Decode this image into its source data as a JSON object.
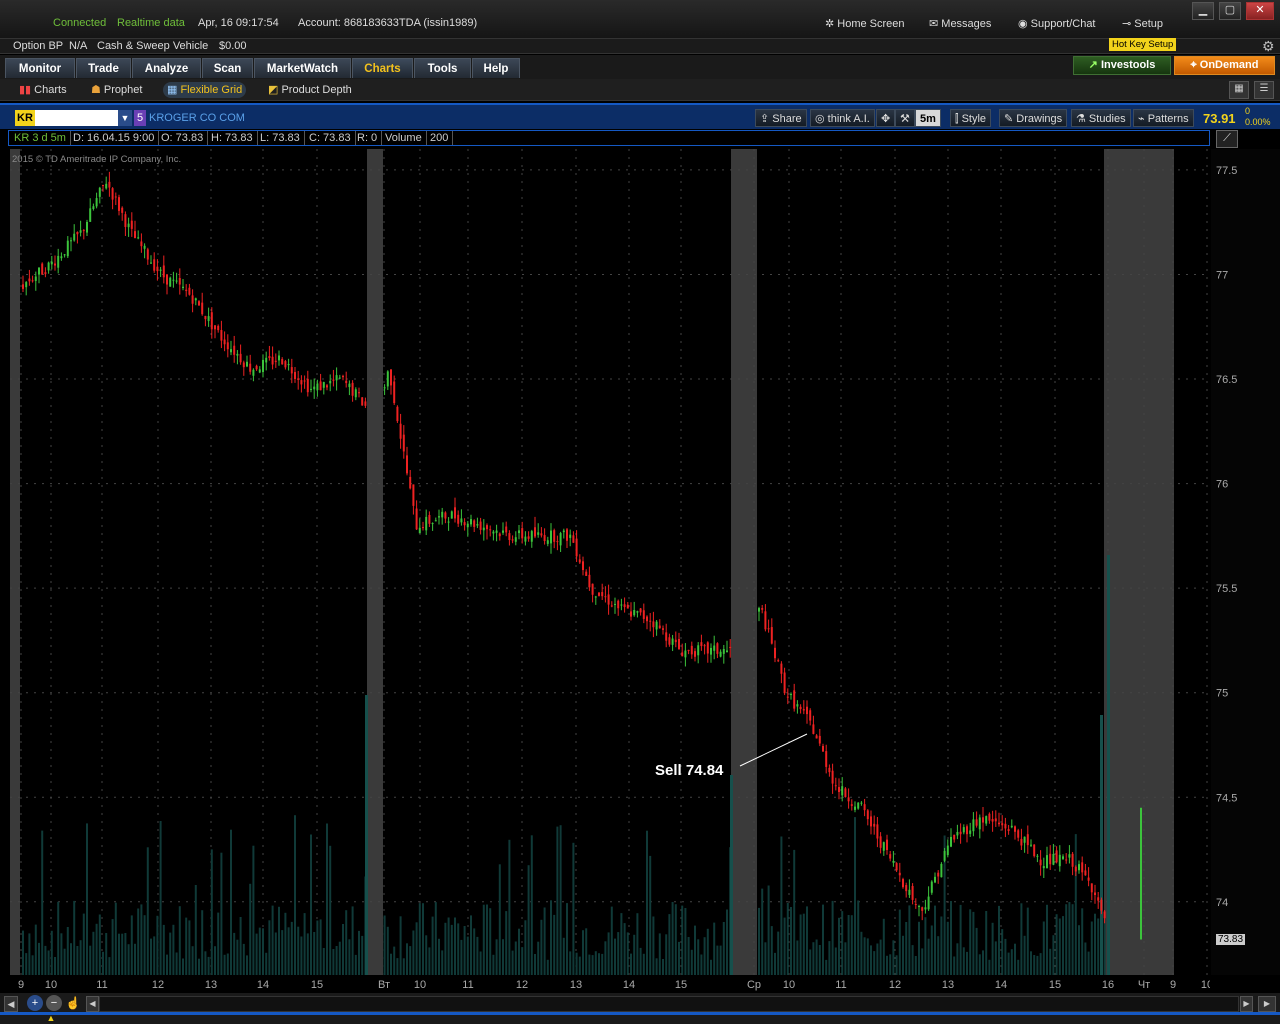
{
  "status": {
    "connected": "Connected",
    "realtime": "Realtime data",
    "datetime": "Apr, 16  09:17:54",
    "account": "Account: 868183633TDA (issin1989)"
  },
  "topnav": {
    "home": "Home Screen",
    "messages": "Messages",
    "support": "Support/Chat",
    "setup": "Setup",
    "hotkey": "Hot Key Setup"
  },
  "account": {
    "option_bp_label": "Option BP",
    "option_bp_value": "N/A",
    "cash_label": "Cash & Sweep Vehicle",
    "cash_value": "$0.00"
  },
  "tabs": [
    "Monitor",
    "Trade",
    "Analyze",
    "Scan",
    "MarketWatch",
    "Charts",
    "Tools",
    "Help"
  ],
  "right_buttons": {
    "investools": "Investools",
    "ondemand": "OnDemand"
  },
  "subtabs": [
    "Charts",
    "Prophet",
    "Flexible Grid",
    "Product Depth"
  ],
  "chart_header": {
    "symbol": "KR",
    "badge": "5",
    "company": "KROGER CO COM",
    "share": "Share",
    "thinkai": "think A.I.",
    "timeframe": "5m",
    "style": "Style",
    "drawings": "Drawings",
    "studies": "Studies",
    "patterns": "Patterns",
    "last_price": "73.91",
    "change": "0",
    "change_pct": "0.00%"
  },
  "study_row": {
    "name": "KR 3 d 5m",
    "date": "D: 16.04.15 9:00",
    "open": "O: 73.83",
    "high": "H: 73.83",
    "low": "L: 73.83",
    "close": "C: 73.83",
    "range": "R: 0",
    "volume_label": "Volume",
    "volume_value": "200"
  },
  "copyright": "2015 © TD Ameritrade IP Company, Inc.",
  "annotation": "Sell 74.84",
  "chart_data": {
    "type": "candlestick",
    "title": "KR 3 d 5m",
    "ylim": [
      73.65,
      77.6
    ],
    "y_ticks": [
      74,
      74.5,
      75,
      75.5,
      76,
      76.5,
      77,
      77.5
    ],
    "x_tick_labels": [
      "9",
      "10",
      "11",
      "12",
      "13",
      "14",
      "15",
      "Вт",
      "10",
      "11",
      "12",
      "13",
      "14",
      "15",
      "Ср",
      "10",
      "11",
      "12",
      "13",
      "14",
      "15",
      "16",
      "Чт",
      "9",
      "10"
    ],
    "price_path": [
      [
        "9:30",
        76.95
      ],
      [
        "10:00",
        77.05
      ],
      [
        "10:30",
        77.2
      ],
      [
        "11:00",
        77.45
      ],
      [
        "11:30",
        77.2
      ],
      [
        "12:00",
        77.0
      ],
      [
        "12:30",
        76.9
      ],
      [
        "13:00",
        76.7
      ],
      [
        "13:30",
        76.55
      ],
      [
        "14:00",
        76.6
      ],
      [
        "14:30",
        76.45
      ],
      [
        "15:00",
        76.5
      ],
      [
        "15:30",
        76.4
      ],
      [
        "16:00",
        76.3
      ],
      [
        "Вт 9:30",
        76.55
      ],
      [
        "10:00",
        75.8
      ],
      [
        "10:30",
        75.85
      ],
      [
        "11:00",
        75.8
      ],
      [
        "11:30",
        75.75
      ],
      [
        "12:00",
        75.75
      ],
      [
        "12:30",
        75.75
      ],
      [
        "13:00",
        75.5
      ],
      [
        "13:30",
        75.4
      ],
      [
        "14:00",
        75.35
      ],
      [
        "14:30",
        75.2
      ],
      [
        "15:00",
        75.2
      ],
      [
        "16:00",
        75.2
      ],
      [
        "Ср 9:30",
        75.4
      ],
      [
        "10:00",
        75.0
      ],
      [
        "10:30",
        74.85
      ],
      [
        "11:00",
        74.55
      ],
      [
        "11:30",
        74.45
      ],
      [
        "12:00",
        74.2
      ],
      [
        "12:30",
        73.95
      ],
      [
        "13:00",
        74.3
      ],
      [
        "13:30",
        74.4
      ],
      [
        "14:00",
        74.35
      ],
      [
        "14:30",
        74.2
      ],
      [
        "15:00",
        74.2
      ],
      [
        "15:30",
        74.05
      ],
      [
        "16:00",
        73.9
      ],
      [
        "Чт 9:00",
        73.83
      ]
    ],
    "current_price_label": "73.83"
  }
}
